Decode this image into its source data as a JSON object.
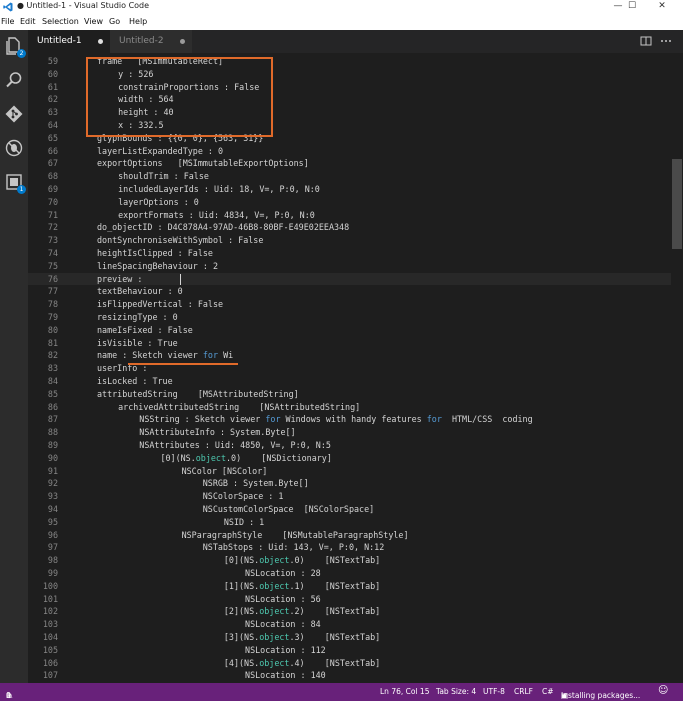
{
  "window": {
    "title": "● Untitled-1 - Visual Studio Code",
    "controls": {
      "minimize": "—",
      "maximize": "☐",
      "close": "✕"
    }
  },
  "menu": [
    "File",
    "Edit",
    "Selection",
    "View",
    "Go",
    "Help"
  ],
  "activity_bar": [
    {
      "icon": "files-icon",
      "badge": "2"
    },
    {
      "icon": "search-icon"
    },
    {
      "icon": "git-icon"
    },
    {
      "icon": "debug-icon"
    },
    {
      "icon": "extensions-icon",
      "badge": "1"
    }
  ],
  "tabs": [
    {
      "label": "Untitled-1",
      "active": true,
      "dirty": true
    },
    {
      "label": "Untitled-2",
      "active": false,
      "dirty": true
    }
  ],
  "editor_actions": [
    "split-editor-icon",
    "more-icon"
  ],
  "lines": [
    {
      "n": "59",
      "indent": 0,
      "text": "frame   [MSImmutableRect]"
    },
    {
      "n": "60",
      "indent": 1,
      "text": "y : 526"
    },
    {
      "n": "61",
      "indent": 1,
      "text": "constrainProportions : False"
    },
    {
      "n": "62",
      "indent": 1,
      "text": "width : 564"
    },
    {
      "n": "63",
      "indent": 1,
      "text": "height : 40"
    },
    {
      "n": "64",
      "indent": 1,
      "text": "x : 332.5"
    },
    {
      "n": "65",
      "indent": 0,
      "text": "glyphBounds : {{0, 0}, {563, 31}}"
    },
    {
      "n": "66",
      "indent": 0,
      "text": "layerListExpandedType : 0"
    },
    {
      "n": "67",
      "indent": 0,
      "text": "exportOptions   [MSImmutableExportOptions]"
    },
    {
      "n": "68",
      "indent": 1,
      "text": "shouldTrim : False"
    },
    {
      "n": "69",
      "indent": 1,
      "text": "includedLayerIds : Uid: 18, V=, P:0, N:0"
    },
    {
      "n": "70",
      "indent": 1,
      "text": "layerOptions : 0"
    },
    {
      "n": "71",
      "indent": 1,
      "text": "exportFormats : Uid: 4834, V=, P:0, N:0"
    },
    {
      "n": "72",
      "indent": 0,
      "text": "do_objectID : D4C878A4-97AD-46B8-80BF-E49E02EEA348"
    },
    {
      "n": "73",
      "indent": 0,
      "text": "dontSynchroniseWithSymbol : False"
    },
    {
      "n": "74",
      "indent": 0,
      "text": "heightIsClipped : False"
    },
    {
      "n": "75",
      "indent": 0,
      "text": "lineSpacingBehaviour : 2"
    },
    {
      "n": "76",
      "indent": 0,
      "text": "preview : "
    },
    {
      "n": "77",
      "indent": 0,
      "text": "textBehaviour : 0"
    },
    {
      "n": "78",
      "indent": 0,
      "text": "isFlippedVertical : False"
    },
    {
      "n": "79",
      "indent": 0,
      "text": "resizingType : 0"
    },
    {
      "n": "80",
      "indent": 0,
      "text": "nameIsFixed : False"
    },
    {
      "n": "81",
      "indent": 0,
      "text": "isVisible : True"
    },
    {
      "n": "82",
      "indent": 0,
      "text": "name : Sketch viewer for Wi"
    },
    {
      "n": "83",
      "indent": 0,
      "text": "userInfo : "
    },
    {
      "n": "84",
      "indent": 0,
      "text": "isLocked : True"
    },
    {
      "n": "85",
      "indent": 0,
      "text": "attributedString    [MSAttributedString]"
    },
    {
      "n": "86",
      "indent": 1,
      "text": "archivedAttributedString    [NSAttributedString]"
    },
    {
      "n": "87",
      "indent": 2,
      "text": "NSString : Sketch viewer for Windows with handy features for  HTML/CSS  coding"
    },
    {
      "n": "88",
      "indent": 2,
      "text": "NSAttributeInfo : System.Byte[]"
    },
    {
      "n": "89",
      "indent": 2,
      "text": "NSAttributes : Uid: 4850, V=, P:0, N:5"
    },
    {
      "n": "90",
      "indent": 3,
      "text": "[0](NS.object.0)    [NSDictionary]"
    },
    {
      "n": "91",
      "indent": 4,
      "text": "NSColor [NSColor]"
    },
    {
      "n": "92",
      "indent": 5,
      "text": "NSRGB : System.Byte[]"
    },
    {
      "n": "93",
      "indent": 5,
      "text": "NSColorSpace : 1"
    },
    {
      "n": "94",
      "indent": 5,
      "text": "NSCustomColorSpace  [NSColorSpace]"
    },
    {
      "n": "95",
      "indent": 6,
      "text": "NSID : 1"
    },
    {
      "n": "96",
      "indent": 4,
      "text": "NSParagraphStyle    [NSMutableParagraphStyle]"
    },
    {
      "n": "97",
      "indent": 5,
      "text": "NSTabStops : Uid: 143, V=, P:0, N:12"
    },
    {
      "n": "98",
      "indent": 6,
      "text": "[0](NS.object.0)    [NSTextTab]"
    },
    {
      "n": "99",
      "indent": 7,
      "text": "NSLocation : 28"
    },
    {
      "n": "100",
      "indent": 6,
      "text": "[1](NS.object.1)    [NSTextTab]"
    },
    {
      "n": "101",
      "indent": 7,
      "text": "NSLocation : 56"
    },
    {
      "n": "102",
      "indent": 6,
      "text": "[2](NS.object.2)    [NSTextTab]"
    },
    {
      "n": "103",
      "indent": 7,
      "text": "NSLocation : 84"
    },
    {
      "n": "104",
      "indent": 6,
      "text": "[3](NS.object.3)    [NSTextTab]"
    },
    {
      "n": "105",
      "indent": 7,
      "text": "NSLocation : 112"
    },
    {
      "n": "106",
      "indent": 6,
      "text": "[4](NS.object.4)    [NSTextTab]"
    },
    {
      "n": "107",
      "indent": 7,
      "text": "NSLocation : 140"
    }
  ],
  "status": {
    "errors": "0",
    "warnings": "0",
    "position": "Ln 76, Col 15",
    "tab_size": "Tab Size: 4",
    "encoding": "UTF-8",
    "eol": "CRLF",
    "language": "C#",
    "task": "Installing packages...",
    "feedback_icon": "smiley-icon"
  },
  "colors": {
    "status_bar": "#68217a",
    "annotation": "#e06a2a",
    "type_highlight": "#4ec9b0",
    "keyword_highlight": "#569cd6"
  }
}
